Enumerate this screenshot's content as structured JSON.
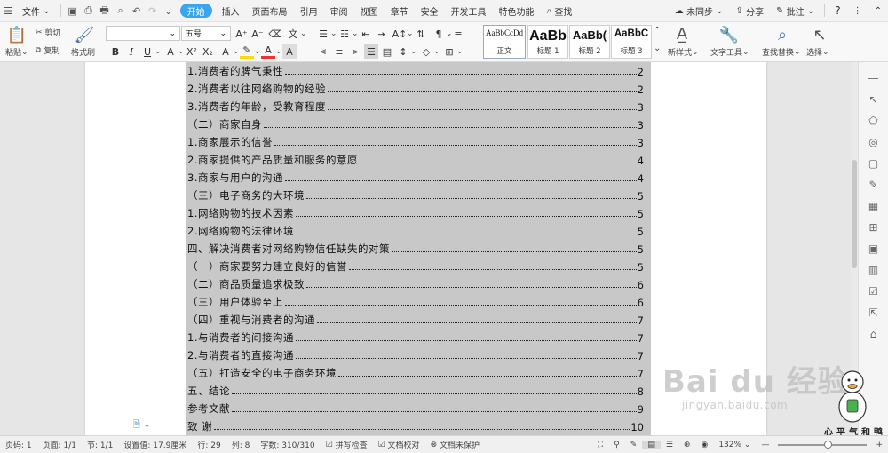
{
  "menubar": {
    "file": "文件",
    "tabs": [
      "开始",
      "插入",
      "页面布局",
      "引用",
      "审阅",
      "视图",
      "章节",
      "安全",
      "开发工具",
      "特色功能"
    ],
    "active_tab": "开始",
    "search": "查找",
    "sync": "未同步",
    "share": "分享",
    "annotate": "批注",
    "help": "?"
  },
  "ribbon": {
    "paste": "粘贴",
    "cut": "剪切",
    "copy": "复制",
    "format_painter": "格式刷",
    "font_size": "五号",
    "styles": [
      {
        "preview": "AaBbCcDd",
        "label": "正文"
      },
      {
        "preview": "AaBb",
        "label": "标题 1"
      },
      {
        "preview": "AaBb(",
        "label": "标题 2"
      },
      {
        "preview": "AaBbC",
        "label": "标题 3"
      }
    ],
    "new_style": "新样式",
    "text_tools": "文字工具",
    "find_replace": "查找替换",
    "select": "选择"
  },
  "toc": [
    {
      "text": "1.消费者的脾气秉性",
      "page": "2"
    },
    {
      "text": "2.消费者以往网络购物的经验",
      "page": "2"
    },
    {
      "text": "3.消费者的年龄，受教育程度",
      "page": "3"
    },
    {
      "text": "（二）商家自身",
      "page": "3"
    },
    {
      "text": "1.商家展示的信誉",
      "page": "3"
    },
    {
      "text": "2.商家提供的产品质量和服务的意愿",
      "page": "4"
    },
    {
      "text": "3.商家与用户的沟通",
      "page": "4"
    },
    {
      "text": "（三）电子商务的大环境",
      "page": "5"
    },
    {
      "text": "1.网络购物的技术因素",
      "page": "5"
    },
    {
      "text": "2.网络购物的法律环境",
      "page": "5"
    },
    {
      "text": "四、解决消费者对网络购物信任缺失的对策",
      "page": "5"
    },
    {
      "text": "（一）商家要努力建立良好的信誉",
      "page": "5"
    },
    {
      "text": "（二）商品质量追求极致",
      "page": "6"
    },
    {
      "text": "（三）用户体验至上",
      "page": "6"
    },
    {
      "text": "（四）重视与消费者的沟通",
      "page": "7"
    },
    {
      "text": "1.与消费者的间接沟通",
      "page": "7"
    },
    {
      "text": "2.与消费者的直接沟通",
      "page": "7"
    },
    {
      "text": "（五）打造安全的电子商务环境",
      "page": "7"
    },
    {
      "text": "五、结论",
      "page": "8"
    },
    {
      "text": "参考文献",
      "page": "9"
    },
    {
      "text": "致  谢",
      "page": "10"
    }
  ],
  "statusbar": {
    "page_num": "页码: 1",
    "pages": "页面: 1/1",
    "section": "节: 1/1",
    "setting": "设置值: 17.9厘米",
    "row": "行: 29",
    "col": "列: 8",
    "wordcount": "字数: 310/310",
    "spellcheck": "拼写检查",
    "proofread": "文档校对",
    "protect": "文档未保护",
    "zoom": "132%"
  },
  "watermark": {
    "main": "Bai du 经验",
    "sub": "jingyan.baidu.com"
  },
  "signature": "心平气和鸭",
  "colors": {
    "active_tab": "#3aa5ef",
    "selection": "#c8c8c8",
    "page": "#ffffff"
  }
}
